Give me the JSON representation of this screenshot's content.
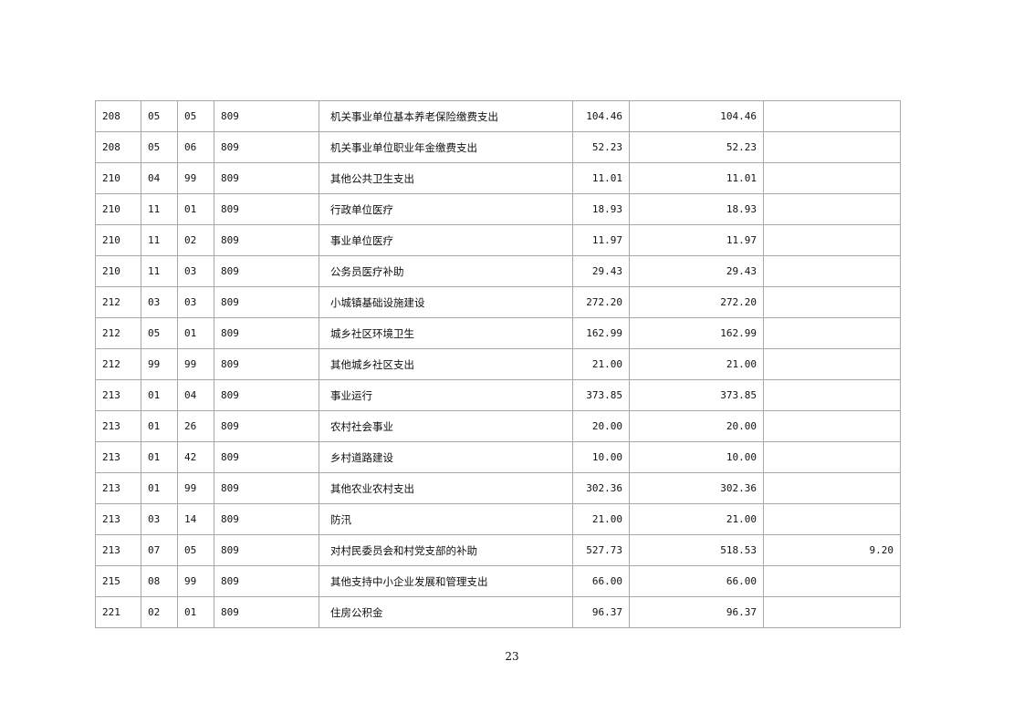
{
  "table": {
    "rows": [
      {
        "c1": "208",
        "c2": "05",
        "c3": "05",
        "c4": "809",
        "name": "机关事业单位基本养老保险缴费支出",
        "total": "104.46",
        "basic": "104.46",
        "project": ""
      },
      {
        "c1": "208",
        "c2": "05",
        "c3": "06",
        "c4": "809",
        "name": "机关事业单位职业年金缴费支出",
        "total": "52.23",
        "basic": "52.23",
        "project": ""
      },
      {
        "c1": "210",
        "c2": "04",
        "c3": "99",
        "c4": "809",
        "name": "其他公共卫生支出",
        "total": "11.01",
        "basic": "11.01",
        "project": ""
      },
      {
        "c1": "210",
        "c2": "11",
        "c3": "01",
        "c4": "809",
        "name": "行政单位医疗",
        "total": "18.93",
        "basic": "18.93",
        "project": ""
      },
      {
        "c1": "210",
        "c2": "11",
        "c3": "02",
        "c4": "809",
        "name": "事业单位医疗",
        "total": "11.97",
        "basic": "11.97",
        "project": ""
      },
      {
        "c1": "210",
        "c2": "11",
        "c3": "03",
        "c4": "809",
        "name": "公务员医疗补助",
        "total": "29.43",
        "basic": "29.43",
        "project": ""
      },
      {
        "c1": "212",
        "c2": "03",
        "c3": "03",
        "c4": "809",
        "name": "小城镇基础设施建设",
        "total": "272.20",
        "basic": "272.20",
        "project": ""
      },
      {
        "c1": "212",
        "c2": "05",
        "c3": "01",
        "c4": "809",
        "name": "城乡社区环境卫生",
        "total": "162.99",
        "basic": "162.99",
        "project": ""
      },
      {
        "c1": "212",
        "c2": "99",
        "c3": "99",
        "c4": "809",
        "name": "其他城乡社区支出",
        "total": "21.00",
        "basic": "21.00",
        "project": ""
      },
      {
        "c1": "213",
        "c2": "01",
        "c3": "04",
        "c4": "809",
        "name": "事业运行",
        "total": "373.85",
        "basic": "373.85",
        "project": ""
      },
      {
        "c1": "213",
        "c2": "01",
        "c3": "26",
        "c4": "809",
        "name": "农村社会事业",
        "total": "20.00",
        "basic": "20.00",
        "project": ""
      },
      {
        "c1": "213",
        "c2": "01",
        "c3": "42",
        "c4": "809",
        "name": "乡村道路建设",
        "total": "10.00",
        "basic": "10.00",
        "project": ""
      },
      {
        "c1": "213",
        "c2": "01",
        "c3": "99",
        "c4": "809",
        "name": "其他农业农村支出",
        "total": "302.36",
        "basic": "302.36",
        "project": ""
      },
      {
        "c1": "213",
        "c2": "03",
        "c3": "14",
        "c4": "809",
        "name": "防汛",
        "total": "21.00",
        "basic": "21.00",
        "project": ""
      },
      {
        "c1": "213",
        "c2": "07",
        "c3": "05",
        "c4": "809",
        "name": "对村民委员会和村党支部的补助",
        "total": "527.73",
        "basic": "518.53",
        "project": "9.20"
      },
      {
        "c1": "215",
        "c2": "08",
        "c3": "99",
        "c4": "809",
        "name": "其他支持中小企业发展和管理支出",
        "total": "66.00",
        "basic": "66.00",
        "project": ""
      },
      {
        "c1": "221",
        "c2": "02",
        "c3": "01",
        "c4": "809",
        "name": "住房公积金",
        "total": "96.37",
        "basic": "96.37",
        "project": ""
      }
    ]
  },
  "footer": {
    "page_number": "23"
  }
}
